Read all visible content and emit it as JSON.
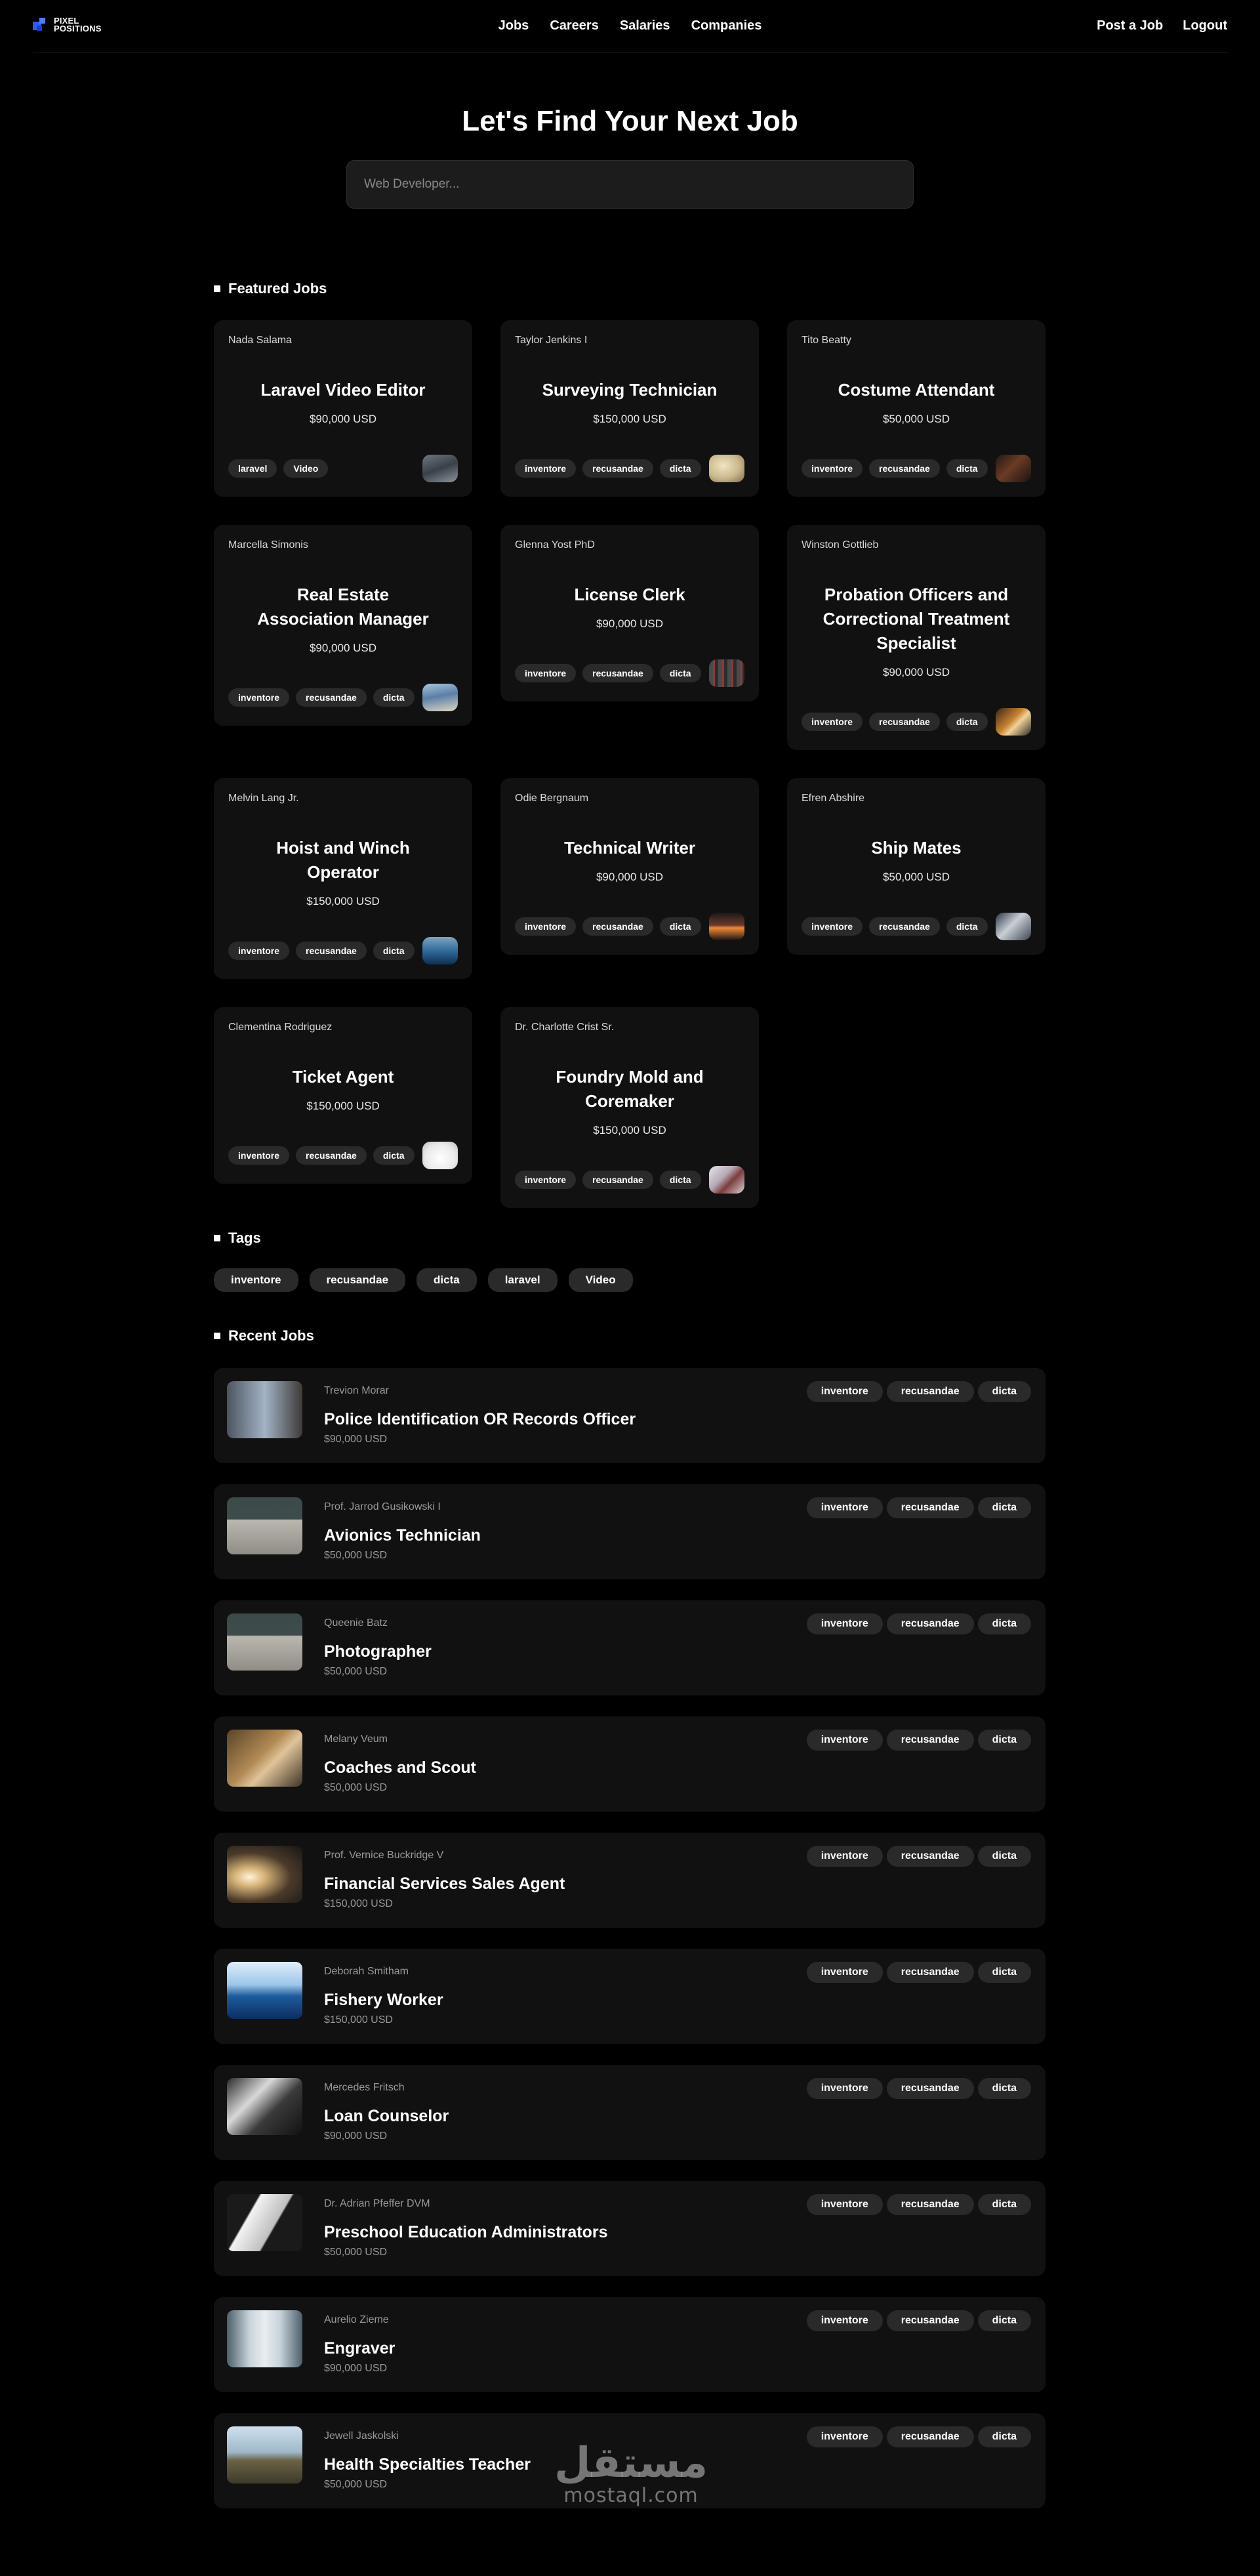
{
  "nav": {
    "logo_line1": "PIXEL",
    "logo_line2": "POSITIONS",
    "links": [
      "Jobs",
      "Careers",
      "Salaries",
      "Companies"
    ],
    "right": [
      "Post a Job",
      "Logout"
    ]
  },
  "hero": {
    "title": "Let's Find Your Next Job",
    "search_placeholder": "Web Developer..."
  },
  "sections": {
    "featured": "Featured Jobs",
    "tags": "Tags",
    "recent": "Recent Jobs"
  },
  "featured_jobs": [
    {
      "employer": "Nada Salama",
      "title": "Laravel Video Editor",
      "salary": "$90,000 USD",
      "tags": [
        "laravel",
        "Video"
      ],
      "thumb": "city"
    },
    {
      "employer": "Taylor Jenkins I",
      "title": "Surveying Technician",
      "salary": "$150,000 USD",
      "tags": [
        "inventore",
        "recusandae",
        "dicta"
      ],
      "thumb": "beige"
    },
    {
      "employer": "Tito Beatty",
      "title": "Costume Attendant",
      "salary": "$50,000 USD",
      "tags": [
        "inventore",
        "recusandae",
        "dicta"
      ],
      "thumb": "dark-warm"
    },
    {
      "employer": "Marcella Simonis",
      "title": "Real Estate Association Manager",
      "salary": "$90,000 USD",
      "tags": [
        "inventore",
        "recusandae",
        "dicta"
      ],
      "thumb": "blue-field"
    },
    {
      "employer": "Glenna Yost PhD",
      "title": "License Clerk",
      "salary": "$90,000 USD",
      "tags": [
        "inventore",
        "recusandae",
        "dicta"
      ],
      "thumb": "machine"
    },
    {
      "employer": "Winston Gottlieb",
      "title": "Probation Officers and Correctional Treatment Specialist",
      "salary": "$90,000 USD",
      "tags": [
        "inventore",
        "recusandae",
        "dicta"
      ],
      "thumb": "orange"
    },
    {
      "employer": "Melvin Lang Jr.",
      "title": "Hoist and Winch Operator",
      "salary": "$150,000 USD",
      "tags": [
        "inventore",
        "recusandae",
        "dicta"
      ],
      "thumb": "sea"
    },
    {
      "employer": "Odie Bergnaum",
      "title": "Technical Writer",
      "salary": "$90,000 USD",
      "tags": [
        "inventore",
        "recusandae",
        "dicta"
      ],
      "thumb": "sunset"
    },
    {
      "employer": "Efren Abshire",
      "title": "Ship Mates",
      "salary": "$50,000 USD",
      "tags": [
        "inventore",
        "recusandae",
        "dicta"
      ],
      "thumb": "rocks"
    },
    {
      "employer": "Clementina Rodriguez",
      "title": "Ticket Agent",
      "salary": "$150,000 USD",
      "tags": [
        "inventore",
        "recusandae",
        "dicta"
      ],
      "thumb": "white"
    },
    {
      "employer": "Dr. Charlotte Crist Sr.",
      "title": "Foundry Mold and Coremaker",
      "salary": "$150,000 USD",
      "tags": [
        "inventore",
        "recusandae",
        "dicta"
      ],
      "thumb": "room"
    }
  ],
  "tags": [
    "inventore",
    "recusandae",
    "dicta",
    "laravel",
    "Video"
  ],
  "recent_jobs": [
    {
      "employer": "Trevion Morar",
      "title": "Police Identification OR Records Officer",
      "salary": "$90,000 USD",
      "tags": [
        "inventore",
        "recusandae",
        "dicta"
      ],
      "thumb": "street"
    },
    {
      "employer": "Prof. Jarrod Gusikowski I",
      "title": "Avionics Technician",
      "salary": "$50,000 USD",
      "tags": [
        "inventore",
        "recusandae",
        "dicta"
      ],
      "thumb": "wall"
    },
    {
      "employer": "Queenie Batz",
      "title": "Photographer",
      "salary": "$50,000 USD",
      "tags": [
        "inventore",
        "recusandae",
        "dicta"
      ],
      "thumb": "wall"
    },
    {
      "employer": "Melany Veum",
      "title": "Coaches and Scout",
      "salary": "$50,000 USD",
      "tags": [
        "inventore",
        "recusandae",
        "dicta"
      ],
      "thumb": "sand"
    },
    {
      "employer": "Prof. Vernice Buckridge V",
      "title": "Financial Services Sales Agent",
      "salary": "$150,000 USD",
      "tags": [
        "inventore",
        "recusandae",
        "dicta"
      ],
      "thumb": "tunnel"
    },
    {
      "employer": "Deborah Smitham",
      "title": "Fishery Worker",
      "salary": "$150,000 USD",
      "tags": [
        "inventore",
        "recusandae",
        "dicta"
      ],
      "thumb": "ocean"
    },
    {
      "employer": "Mercedes Fritsch",
      "title": "Loan Counselor",
      "salary": "$90,000 USD",
      "tags": [
        "inventore",
        "recusandae",
        "dicta"
      ],
      "thumb": "camera"
    },
    {
      "employer": "Dr. Adrian Pfeffer DVM",
      "title": "Preschool Education Administrators",
      "salary": "$50,000 USD",
      "tags": [
        "inventore",
        "recusandae",
        "dicta"
      ],
      "thumb": "paper"
    },
    {
      "employer": "Aurelio Zieme",
      "title": "Engraver",
      "salary": "$90,000 USD",
      "tags": [
        "inventore",
        "recusandae",
        "dicta"
      ],
      "thumb": "building"
    },
    {
      "employer": "Jewell Jaskolski",
      "title": "Health Specialties Teacher",
      "salary": "$50,000 USD",
      "tags": [
        "inventore",
        "recusandae",
        "dicta"
      ],
      "thumb": "landscape"
    }
  ],
  "watermark": {
    "arabic": "مستقل",
    "latin": "mostaql.com"
  },
  "colors": {
    "background": "#000000",
    "card": "#111111",
    "tag": "#2a2a2a",
    "logo_blue": "#2b5cff"
  }
}
